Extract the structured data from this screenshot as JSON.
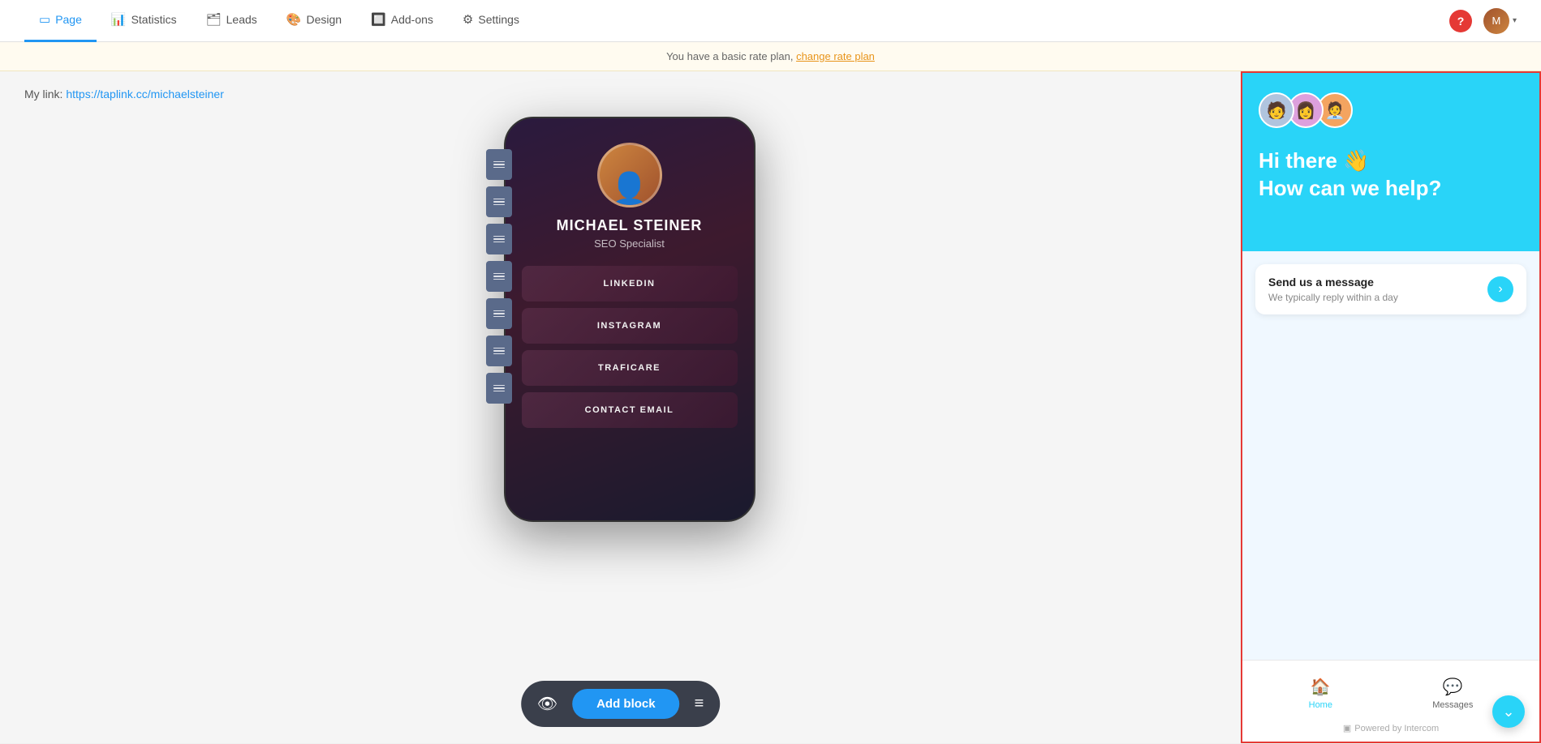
{
  "nav": {
    "items": [
      {
        "id": "page",
        "label": "Page",
        "icon": "🖥",
        "active": true
      },
      {
        "id": "statistics",
        "label": "Statistics",
        "icon": "📊",
        "active": false
      },
      {
        "id": "leads",
        "label": "Leads",
        "icon": "🗂",
        "active": false
      },
      {
        "id": "design",
        "label": "Design",
        "icon": "🎨",
        "active": false
      },
      {
        "id": "addons",
        "label": "Add-ons",
        "icon": "🔲",
        "active": false
      },
      {
        "id": "settings",
        "label": "Settings",
        "icon": "⚙",
        "active": false
      }
    ]
  },
  "banner": {
    "text": "You have a basic rate plan,",
    "link_text": "change rate plan"
  },
  "page": {
    "my_link_label": "My link:",
    "my_link_url": "https://taplink.cc/michaelsteiner"
  },
  "phone": {
    "profile_name": "MICHAEL STEINER",
    "profile_title": "SEO Specialist",
    "buttons": [
      {
        "label": "LINKEDIN"
      },
      {
        "label": "INSTAGRAM"
      },
      {
        "label": "TRAFICARE"
      },
      {
        "label": "CONTACT EMAIL"
      }
    ]
  },
  "toolbar": {
    "add_block_label": "Add block"
  },
  "intercom": {
    "greeting_line1": "Hi there 👋",
    "greeting_line2": "How can we help?",
    "message_card": {
      "title": "Send us a message",
      "subtitle": "We typically reply within a day"
    },
    "tabs": [
      {
        "id": "home",
        "label": "Home",
        "icon": "🏠",
        "active": true
      },
      {
        "id": "messages",
        "label": "Messages",
        "icon": "💬",
        "active": false
      }
    ],
    "powered_by": "Powered by Intercom"
  }
}
